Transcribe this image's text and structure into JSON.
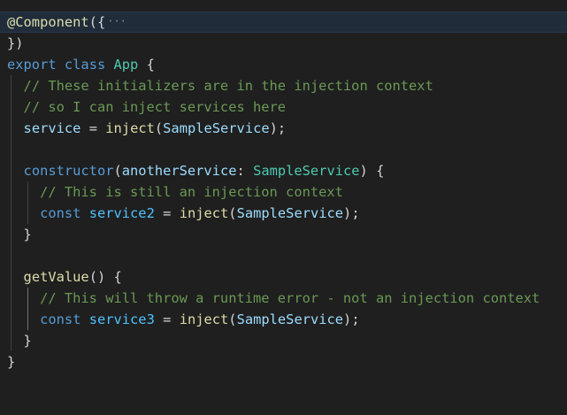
{
  "editor": {
    "background": "#1f1f1f",
    "lines": [
      {
        "t1": "@Component",
        "t2": "({",
        "fold": "···"
      },
      {
        "t1": "})"
      },
      {
        "t1": "export",
        "t2": "class",
        "t3": "App",
        "t4": "{"
      },
      {
        "t1": "// These initializers are in the injection context"
      },
      {
        "t1": "// so I can inject services here"
      },
      {
        "t1": "service",
        "t2": "=",
        "t3": "inject",
        "t4": "(",
        "t5": "SampleService",
        "t6": ");"
      },
      {},
      {
        "t1": "constructor",
        "t2": "(",
        "t3": "anotherService",
        "t4": ":",
        "t5": "SampleService",
        "t6": ")",
        "t7": "{"
      },
      {
        "t1": "// This is still an injection context"
      },
      {
        "t1": "const",
        "t2": "service2",
        "t3": "=",
        "t4": "inject",
        "t5": "(",
        "t6": "SampleService",
        "t7": ");"
      },
      {
        "t1": "}"
      },
      {},
      {
        "t1": "getValue",
        "t2": "()",
        "t3": "{"
      },
      {
        "t1": "// This will throw a runtime error - not an injection context"
      },
      {
        "t1": "const",
        "t2": "service3",
        "t3": "=",
        "t4": "inject",
        "t5": "(",
        "t6": "SampleService",
        "t7": ");"
      },
      {
        "t1": "}"
      },
      {
        "t1": "}"
      }
    ]
  }
}
